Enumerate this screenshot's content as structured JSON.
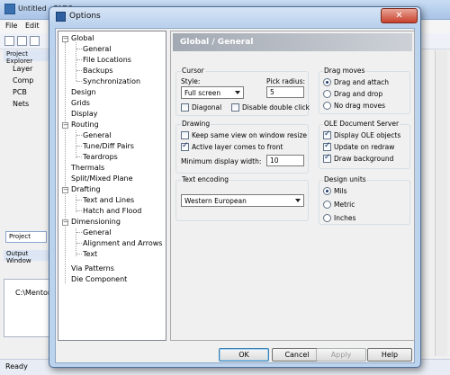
{
  "app": {
    "title": "Untitled - PADS",
    "menus": [
      "File",
      "Edit"
    ],
    "explorer_title": "Project Explorer",
    "explorer_items": [
      "Layer",
      "Comp",
      "PCB",
      "Nets"
    ],
    "tab_label": "Project",
    "output_title": "Output Window",
    "output_text": "C:\\Mentor",
    "status": "Ready"
  },
  "dialog": {
    "title": "Options",
    "close_glyph": "✕",
    "tree": [
      {
        "label": "Global",
        "children": [
          "General",
          "File Locations",
          "Backups",
          "Synchronization"
        ]
      },
      {
        "label": "Design"
      },
      {
        "label": "Grids"
      },
      {
        "label": "Display"
      },
      {
        "label": "Routing",
        "children": [
          "General",
          "Tune/Diff Pairs",
          "Teardrops"
        ]
      },
      {
        "label": "Thermals"
      },
      {
        "label": "Split/Mixed Plane"
      },
      {
        "label": "Drafting",
        "children": [
          "Text and Lines",
          "Hatch and Flood"
        ]
      },
      {
        "label": "Dimensioning",
        "children": [
          "General",
          "Alignment and Arrows",
          "Text"
        ]
      },
      {
        "label": "Via Patterns"
      },
      {
        "label": "Die Component"
      }
    ],
    "page_title": "Global / General",
    "cursor": {
      "group": "Cursor",
      "style_label": "Style:",
      "style_value": "Full screen",
      "pick_label": "Pick radius:",
      "pick_value": "5",
      "diagonal_label": "Diagonal",
      "diagonal_checked": false,
      "dblclick_label": "Disable double click",
      "dblclick_checked": false
    },
    "drawing": {
      "group": "Drawing",
      "keep_label": "Keep same view on window resize",
      "keep_checked": false,
      "active_label": "Active layer comes to front",
      "active_checked": true,
      "min_width_label": "Minimum display width:",
      "min_width_value": "10"
    },
    "encoding": {
      "group": "Text encoding",
      "value": "Western European"
    },
    "drag": {
      "group": "Drag moves",
      "options": [
        "Drag and attach",
        "Drag and drop",
        "No drag moves"
      ],
      "selected": 0
    },
    "ole": {
      "group": "OLE Document Server",
      "items": [
        {
          "label": "Display OLE objects",
          "checked": true
        },
        {
          "label": "Update on redraw",
          "checked": true
        },
        {
          "label": "Draw background",
          "checked": true
        }
      ]
    },
    "units": {
      "group": "Design units",
      "options": [
        "Mils",
        "Metric",
        "Inches"
      ],
      "selected": 0
    },
    "buttons": {
      "ok": "OK",
      "cancel": "Cancel",
      "apply": "Apply",
      "help": "Help"
    }
  }
}
